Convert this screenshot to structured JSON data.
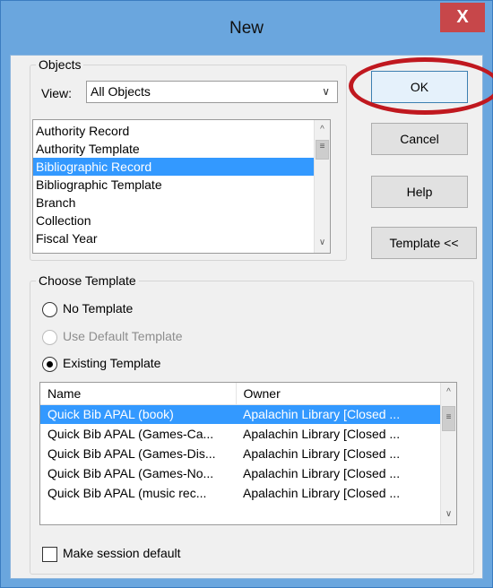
{
  "window": {
    "title": "New",
    "close_glyph": "X"
  },
  "objects": {
    "group_label": "Objects",
    "view_label": "View:",
    "view_value": "All Objects",
    "items": [
      "Authority Record",
      "Authority Template",
      "Bibliographic Record",
      "Bibliographic Template",
      "Branch",
      "Collection",
      "Fiscal Year"
    ],
    "selected_index": 2
  },
  "buttons": {
    "ok": "OK",
    "cancel": "Cancel",
    "help": "Help",
    "template": "Template <<"
  },
  "template": {
    "group_label": "Choose Template",
    "options": {
      "none": "No Template",
      "default": "Use Default Template",
      "existing": "Existing Template"
    },
    "selected_option": "existing",
    "columns": {
      "name": "Name",
      "owner": "Owner"
    },
    "rows": [
      {
        "name": "Quick Bib APAL (book)",
        "owner": "Apalachin Library [Closed ..."
      },
      {
        "name": "Quick Bib APAL (Games-Ca...",
        "owner": "Apalachin Library [Closed ..."
      },
      {
        "name": "Quick Bib APAL (Games-Dis...",
        "owner": "Apalachin Library [Closed ..."
      },
      {
        "name": "Quick Bib APAL (Games-No...",
        "owner": "Apalachin Library [Closed ..."
      },
      {
        "name": "Quick Bib APAL (music rec...",
        "owner": "Apalachin Library [Closed ..."
      }
    ],
    "selected_row": 0
  },
  "session_default_label": "Make session default",
  "colors": {
    "titlebar": "#6aa6de",
    "close_button": "#c7474a",
    "selection": "#3399ff",
    "annotation_circle": "#c0181f"
  },
  "icons": {
    "dropdown": "chevron-down-icon",
    "scroll_up": "chevron-up-icon",
    "scroll_down": "chevron-down-icon",
    "thumb_grip": "grip-icon"
  }
}
